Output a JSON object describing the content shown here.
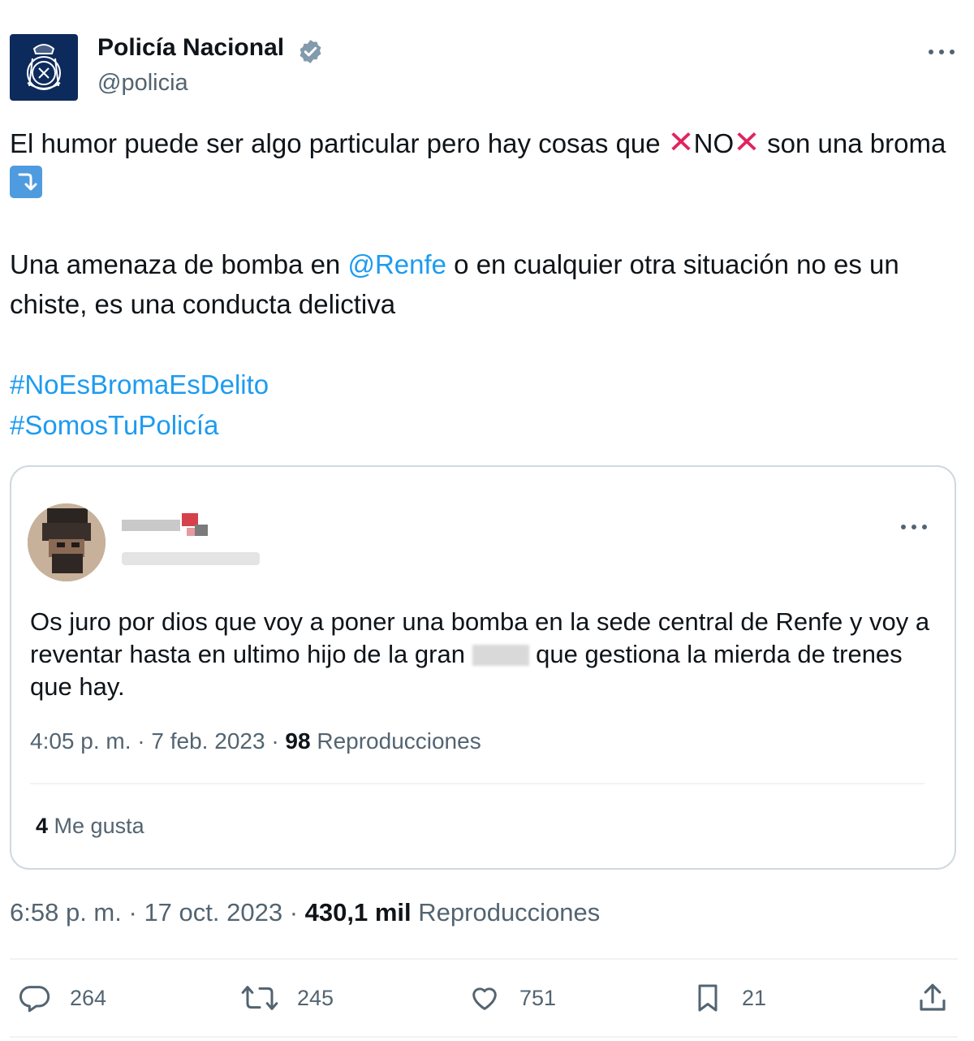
{
  "author": {
    "display_name": "Policía Nacional",
    "handle": "@policia",
    "verified": true,
    "avatar": "police-emblem-icon"
  },
  "tweet": {
    "line1_pre": "El humor puede ser algo particular pero hay cosas que ",
    "line1_no": "NO",
    "line1_post": " son una broma",
    "line2_pre": "Una amenaza de bomba en ",
    "mention": "@Renfe",
    "line2_post": " o en cualquier otra situación no es un chiste, es una conducta delictiva",
    "hashtags": [
      "#NoEsBromaEsDelito",
      "#SomosTuPolicía"
    ],
    "x_emoji_color": "#e0245e",
    "link_color": "#1d9bf0"
  },
  "quoted": {
    "text_pre": "Os juro por dios que voy a poner una bomba en la sede central de Renfe y voy a reventar hasta en ultimo hijo de la gran ",
    "text_post": " que gestiona la mierda de trenes que hay.",
    "time": "4:05 p. m.",
    "date": "7 feb. 2023",
    "views_count": "98",
    "views_label": "Reproducciones",
    "likes_count": "4",
    "likes_label": "Me gusta"
  },
  "meta": {
    "time": "6:58 p. m.",
    "date": "17 oct. 2023",
    "views_count": "430,1 mil",
    "views_label": "Reproducciones",
    "separator": "·"
  },
  "actions": {
    "replies": "264",
    "retweets": "245",
    "likes": "751",
    "bookmarks": "21"
  }
}
